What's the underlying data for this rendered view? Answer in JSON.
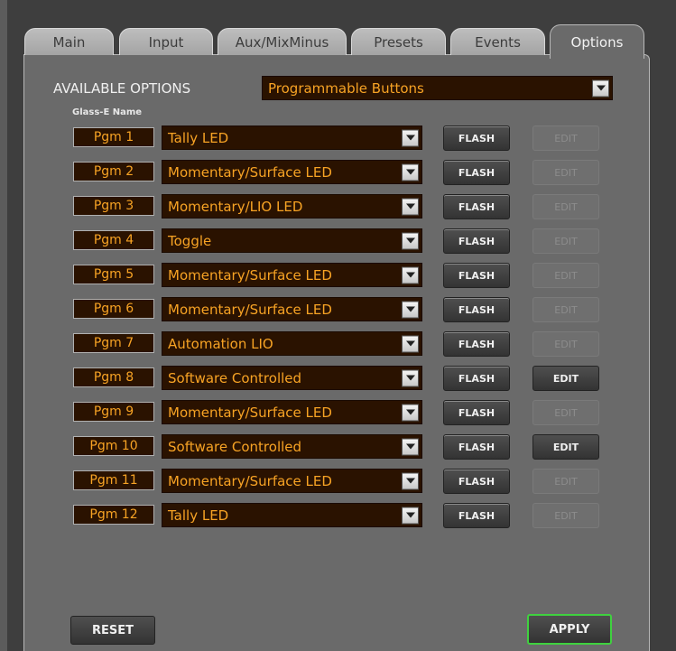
{
  "tabs": [
    {
      "label": "Main",
      "active": false
    },
    {
      "label": "Input",
      "active": false
    },
    {
      "label": "Aux/MixMinus",
      "active": false
    },
    {
      "label": "Presets",
      "active": false
    },
    {
      "label": "Events",
      "active": false
    },
    {
      "label": "Options",
      "active": true
    }
  ],
  "available_options": {
    "label": "AVAILABLE OPTIONS",
    "value": "Programmable Buttons"
  },
  "column_label": "Glass-E Name",
  "flash_label": "FLASH",
  "edit_label": "EDIT",
  "rows": [
    {
      "name": "Pgm 1",
      "mode": "Tally LED",
      "edit_enabled": false
    },
    {
      "name": "Pgm 2",
      "mode": "Momentary/Surface LED",
      "edit_enabled": false
    },
    {
      "name": "Pgm 3",
      "mode": "Momentary/LIO LED",
      "edit_enabled": false
    },
    {
      "name": "Pgm 4",
      "mode": "Toggle",
      "edit_enabled": false
    },
    {
      "name": "Pgm 5",
      "mode": "Momentary/Surface LED",
      "edit_enabled": false
    },
    {
      "name": "Pgm 6",
      "mode": "Momentary/Surface LED",
      "edit_enabled": false
    },
    {
      "name": "Pgm 7",
      "mode": "Automation LIO",
      "edit_enabled": false
    },
    {
      "name": "Pgm 8",
      "mode": "Software Controlled",
      "edit_enabled": true
    },
    {
      "name": "Pgm 9",
      "mode": "Momentary/Surface LED",
      "edit_enabled": false
    },
    {
      "name": "Pgm 10",
      "mode": "Software Controlled",
      "edit_enabled": true
    },
    {
      "name": "Pgm 11",
      "mode": "Momentary/Surface LED",
      "edit_enabled": false
    },
    {
      "name": "Pgm 12",
      "mode": "Tally LED",
      "edit_enabled": false
    }
  ],
  "footer": {
    "reset_label": "RESET",
    "apply_label": "APPLY"
  },
  "colors": {
    "field_text": "#f7a324",
    "field_bg": "#2a1200",
    "apply_border": "#3fd13f"
  }
}
